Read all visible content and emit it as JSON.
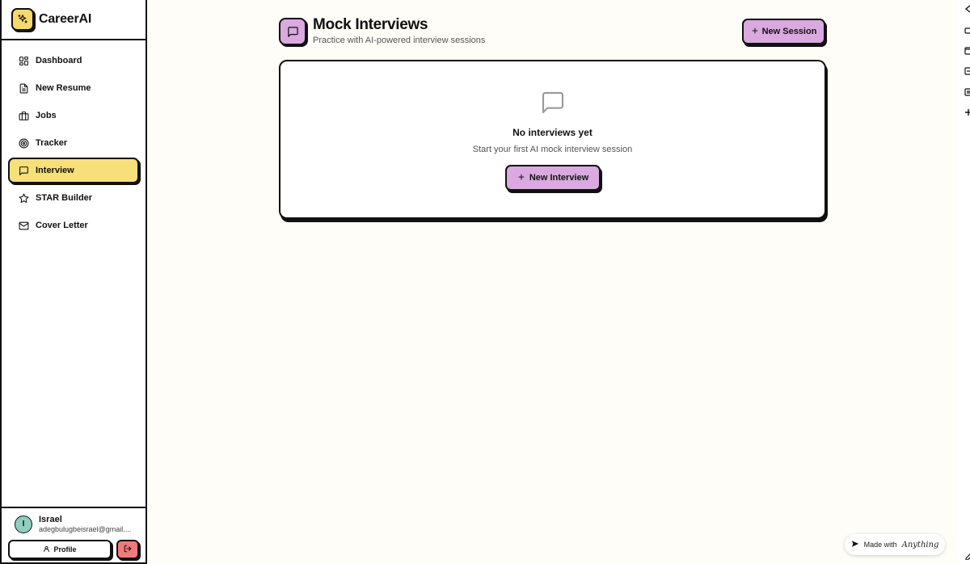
{
  "app": {
    "name": "CareerAI"
  },
  "sidebar": {
    "items": [
      {
        "label": "Dashboard",
        "icon": "grid-icon",
        "active": false
      },
      {
        "label": "New Resume",
        "icon": "file-text-icon",
        "active": false
      },
      {
        "label": "Jobs",
        "icon": "briefcase-icon",
        "active": false
      },
      {
        "label": "Tracker",
        "icon": "target-icon",
        "active": false
      },
      {
        "label": "Interview",
        "icon": "message-square-icon",
        "active": true
      },
      {
        "label": "STAR Builder",
        "icon": "star-icon",
        "active": false
      },
      {
        "label": "Cover Letter",
        "icon": "mail-icon",
        "active": false
      }
    ],
    "user": {
      "initial": "I",
      "name": "Israel",
      "email": "adegbulugbeisrael@gmail...."
    },
    "profile_label": "Profile"
  },
  "main": {
    "title": "Mock Interviews",
    "subtitle": "Practice with AI-powered interview sessions",
    "new_session_label": "New Session",
    "empty_state": {
      "title": "No interviews yet",
      "description": "Start your first AI mock interview session",
      "button_label": "New Interview"
    }
  },
  "badge": {
    "prefix": "Made with",
    "brand": "Anything"
  },
  "colors": {
    "accent_purple": "#d9a9e0",
    "accent_yellow": "#f7e07a",
    "logout_red": "#f27a7a",
    "background": "#fffdf7"
  }
}
